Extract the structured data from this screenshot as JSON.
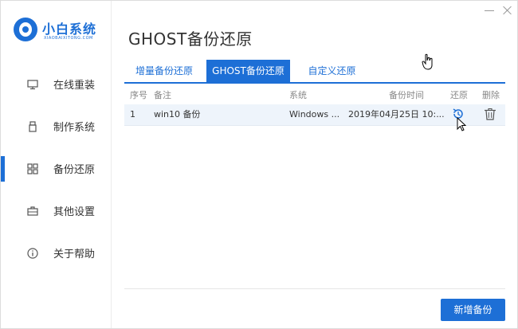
{
  "app": {
    "name": "小白系统",
    "subtitle": "XIAOBAIXITONG.COM",
    "brand_color": "#1d6fd6"
  },
  "page_title": "GHOST备份还原",
  "sidebar": {
    "items": [
      {
        "label": "在线重装",
        "icon": "monitor-icon",
        "active": false
      },
      {
        "label": "制作系统",
        "icon": "usb-icon",
        "active": false
      },
      {
        "label": "备份还原",
        "icon": "grid-icon",
        "active": true
      },
      {
        "label": "其他设置",
        "icon": "briefcase-icon",
        "active": false
      },
      {
        "label": "关于帮助",
        "icon": "info-icon",
        "active": false
      }
    ]
  },
  "tabs": [
    {
      "label": "增量备份还原",
      "active": false
    },
    {
      "label": "GHOST备份还原",
      "active": true
    },
    {
      "label": "自定义还原",
      "active": false
    }
  ],
  "table": {
    "headers": {
      "no": "序号",
      "note": "备注",
      "system": "系统",
      "time": "备份时间",
      "restore": "还原",
      "delete": "删除"
    },
    "rows": [
      {
        "no": "1",
        "note": "win10 备份",
        "system": "Windows ...",
        "time": "2019年04月25日 10:..."
      }
    ]
  },
  "add_button": "新增备份"
}
